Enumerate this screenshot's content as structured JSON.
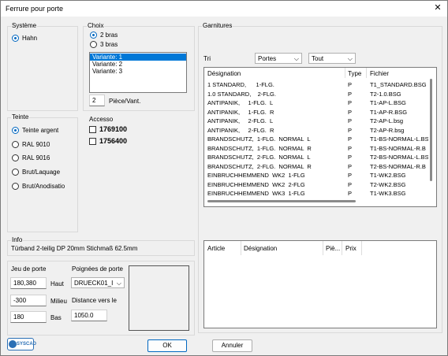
{
  "window": {
    "title": "Ferrure pour porte",
    "close": "✕"
  },
  "systeme": {
    "label": "Système",
    "options": [
      "Hahn"
    ]
  },
  "choix": {
    "label": "Choix",
    "options": [
      "2 bras",
      "3 bras"
    ],
    "variants": [
      "Variante: 1",
      "Variante: 2",
      "Variante: 3"
    ],
    "pieces_value": "2",
    "pieces_label": "Pièce/Vant."
  },
  "teinte": {
    "label": "Teinte",
    "options": [
      "Teinte argent",
      "RAL 9010",
      "RAL 9016",
      "Brut/Laquage",
      "Brut/Anodisatio"
    ]
  },
  "accesso": {
    "label": "Accesso",
    "items": [
      "1769100",
      "1756400"
    ]
  },
  "info": {
    "label": "Info",
    "text": "Türband 2-teilig DP 20mm Stichmaß 62.5mm"
  },
  "jeu": {
    "label": "Jeu de porte",
    "haut_value": "180,380",
    "haut_label": "Haut",
    "milieu_value": "-300",
    "milieu_label": "Milieu",
    "bas_value": "180",
    "bas_label": "Bas"
  },
  "poignees": {
    "label": "Poignées de porte",
    "selected": "DRUECK01_I",
    "distance_label": "Distance vers le",
    "distance_value": "1050.0"
  },
  "garnitures": {
    "label": "Garnitures",
    "tri_label": "Tri",
    "tri_combo1": "Portes",
    "tri_combo2": "Tout",
    "columns": [
      "Désignation",
      "Type",
      "Fichier"
    ],
    "rows": [
      [
        "1 STANDARD,      1-FLG.",
        "P",
        "T1_STANDARD.BSG"
      ],
      [
        "1.0 STANDARD,    2-FLG.",
        "P",
        "T2-1.0.BSG"
      ],
      [
        "ANTIPANIK,     1-FLG.  L",
        "P",
        "T1-AP-L.BSG"
      ],
      [
        "ANTIPANIK,     1-FLG.  R",
        "P",
        "T1-AP-R.BSG"
      ],
      [
        "ANTIPANIK,     2-FLG.  L",
        "P",
        "T2-AP-L.bsg"
      ],
      [
        "ANTIPANIK,     2-FLG.  R",
        "P",
        "T2-AP-R.bsg"
      ],
      [
        "BRANDSCHUTZ,  1-FLG.  NORMAL  L",
        "P",
        "T1-BS-NORMAL-L.BS"
      ],
      [
        "BRANDSCHUTZ,  1-FLG.  NORMAL  R",
        "P",
        "T1-BS-NORMAL-R.B"
      ],
      [
        "BRANDSCHUTZ,  2-FLG.  NORMAL  L",
        "P",
        "T2-BS-NORMAL-L.BS"
      ],
      [
        "BRANDSCHUTZ,  2-FLG.  NORMAL  R",
        "P",
        "T2-BS-NORMAL-R.B"
      ],
      [
        "EINBRUCHHEMMEND  WK2  1-FLG",
        "P",
        "T1-WK2.BSG"
      ],
      [
        "EINBRUCHHEMMEND  WK2  2-FLG",
        "P",
        "T2-WK2.BSG"
      ],
      [
        "EINBRUCHHEMMEND  WK3  1-FLG",
        "P",
        "T1-WK3.BSG"
      ]
    ],
    "article_columns": [
      "Article",
      "Désignation",
      "Piè...",
      "Prix"
    ]
  },
  "buttons": {
    "ok": "OK",
    "cancel": "Annuler"
  },
  "logo": {
    "text": "SYSCAD"
  }
}
